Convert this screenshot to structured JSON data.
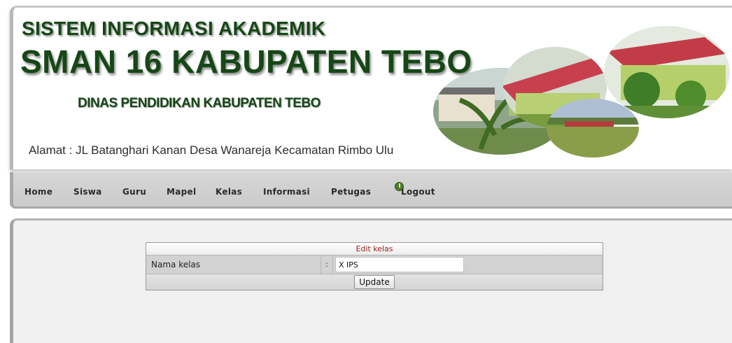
{
  "header": {
    "title_line1": "SISTEM INFORMASI AKADEMIK",
    "title_line2": "SMAN 16 KABUPATEN TEBO",
    "subtitle": "DINAS PENDIDIKAN KABUPATEN TEBO",
    "address": "Alamat : JL Batanghari Kanan Desa Wanareja Kecamatan Rimbo Ulu"
  },
  "nav": {
    "items": [
      "Home",
      "Siswa",
      "Guru",
      "Mapel",
      "Kelas",
      "Informasi",
      "Petugas"
    ],
    "logout_label": "Logout",
    "logout_icon": "power-icon"
  },
  "form": {
    "title": "Edit kelas",
    "field_label": "Nama kelas",
    "separator": ":",
    "field_value": "X IPS",
    "submit_label": "Update"
  },
  "colors": {
    "title_green": "#164716",
    "form_title_red": "#9b1a1a",
    "nav_bg": "#cfcfcf",
    "content_bg": "#f0f0f0"
  }
}
